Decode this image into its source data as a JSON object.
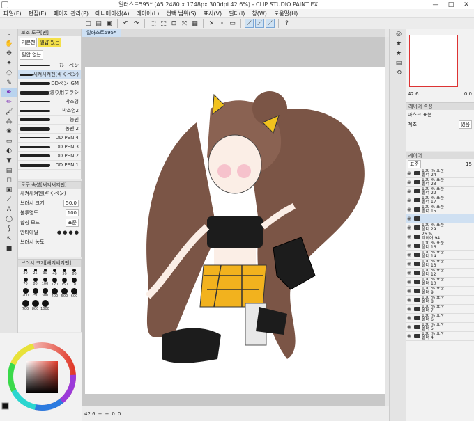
{
  "window": {
    "title": "일러스트595* (A5 2480 x 1748px 300dpi 42.6%) - CLIP STUDIO PAINT EX",
    "minimize": "—",
    "maximize": "□",
    "close": "✕"
  },
  "menu": [
    "파일(F)",
    "편집(E)",
    "페이지 관리(P)",
    "애니메이션(A)",
    "레이어(L)",
    "선택 범위(S)",
    "표시(V)",
    "필터(I)",
    "창(W)",
    "도움말(H)"
  ],
  "subtool": {
    "header": "보조 도구[펜]",
    "group1": "기본펜",
    "group2": "필압 있는",
    "group3": "필압 없는",
    "brushes": [
      "ひーぺン",
      "새켜새켜펜(ギくぺン)",
      "DDペン_GM",
      "濃り用ブラシ",
      "박소영",
      "박소영2",
      "농펜",
      "농펜 2",
      "DD PEN 4",
      "DD PEN 3",
      "DD PEN 2",
      "DD PEN 1"
    ]
  },
  "toolprop": {
    "header": "도구 속성[새켜새켜펜]",
    "brush_name": "새켜새켜펜(ギくぺン)",
    "size_label": "브러시 크기",
    "size_value": "50.0",
    "opacity_label": "불투명도",
    "opacity_value": "100",
    "blend_label": "합성 모드",
    "blend_value": "표준",
    "aa_label": "안티에일",
    "density_label": "브러시 농도"
  },
  "brushsize": {
    "header": "브러시 크기[새켜새켜펜]",
    "sizes": [
      "20",
      "25",
      "30",
      "40",
      "50",
      "60",
      "70",
      "80",
      "100",
      "120",
      "150",
      "170",
      "200",
      "250",
      "300",
      "400",
      "500",
      "600",
      "700",
      "800",
      "1000"
    ]
  },
  "canvas": {
    "tab": "일러스트595*",
    "zoom": "42.6",
    "zero1": "0",
    "zero2": "0"
  },
  "navigator": {
    "zoom": "42.6",
    "angle": "0.0"
  },
  "layerprop": {
    "header": "레이어 속성",
    "mask_label": "마스크 표현",
    "tone_label": "계조",
    "tone_value": "있음"
  },
  "layers": {
    "header": "레이어",
    "blend": "표준",
    "opacity": "15",
    "rows": [
      {
        "pct": "100 % 표준",
        "name": "폴더 24"
      },
      {
        "pct": "100 % 표준",
        "name": "폴더 23"
      },
      {
        "pct": "100 % 표준",
        "name": "폴더 22"
      },
      {
        "pct": "100 % 표준",
        "name": "폴더 17"
      },
      {
        "pct": "100 % 표준",
        "name": "폴더 15"
      },
      {
        "pct": "",
        "name": ""
      },
      {
        "pct": "100 % 표준",
        "name": "폴더 29"
      },
      {
        "pct": "26 %",
        "name": "레이어 94"
      },
      {
        "pct": "100 % 표준",
        "name": "폴더 16"
      },
      {
        "pct": "100 % 표준",
        "name": "폴더 14"
      },
      {
        "pct": "100 % 표준",
        "name": "폴더 13"
      },
      {
        "pct": "100 % 표준",
        "name": "폴더 12"
      },
      {
        "pct": "100 % 표준",
        "name": "폴더 10"
      },
      {
        "pct": "100 % 표준",
        "name": "폴더 9"
      },
      {
        "pct": "100 % 표준",
        "name": "폴더 8"
      },
      {
        "pct": "100 % 표준",
        "name": "폴더 7"
      },
      {
        "pct": "100 % 표준",
        "name": "폴더 6"
      },
      {
        "pct": "100 % 표준",
        "name": "폴더 5"
      },
      {
        "pct": "100 % 표준",
        "name": "폴더 4"
      }
    ]
  },
  "colors": {
    "accent": "#7aa7d6",
    "selection": "#cfe0f2",
    "group_highlight": "#f4e04a"
  }
}
